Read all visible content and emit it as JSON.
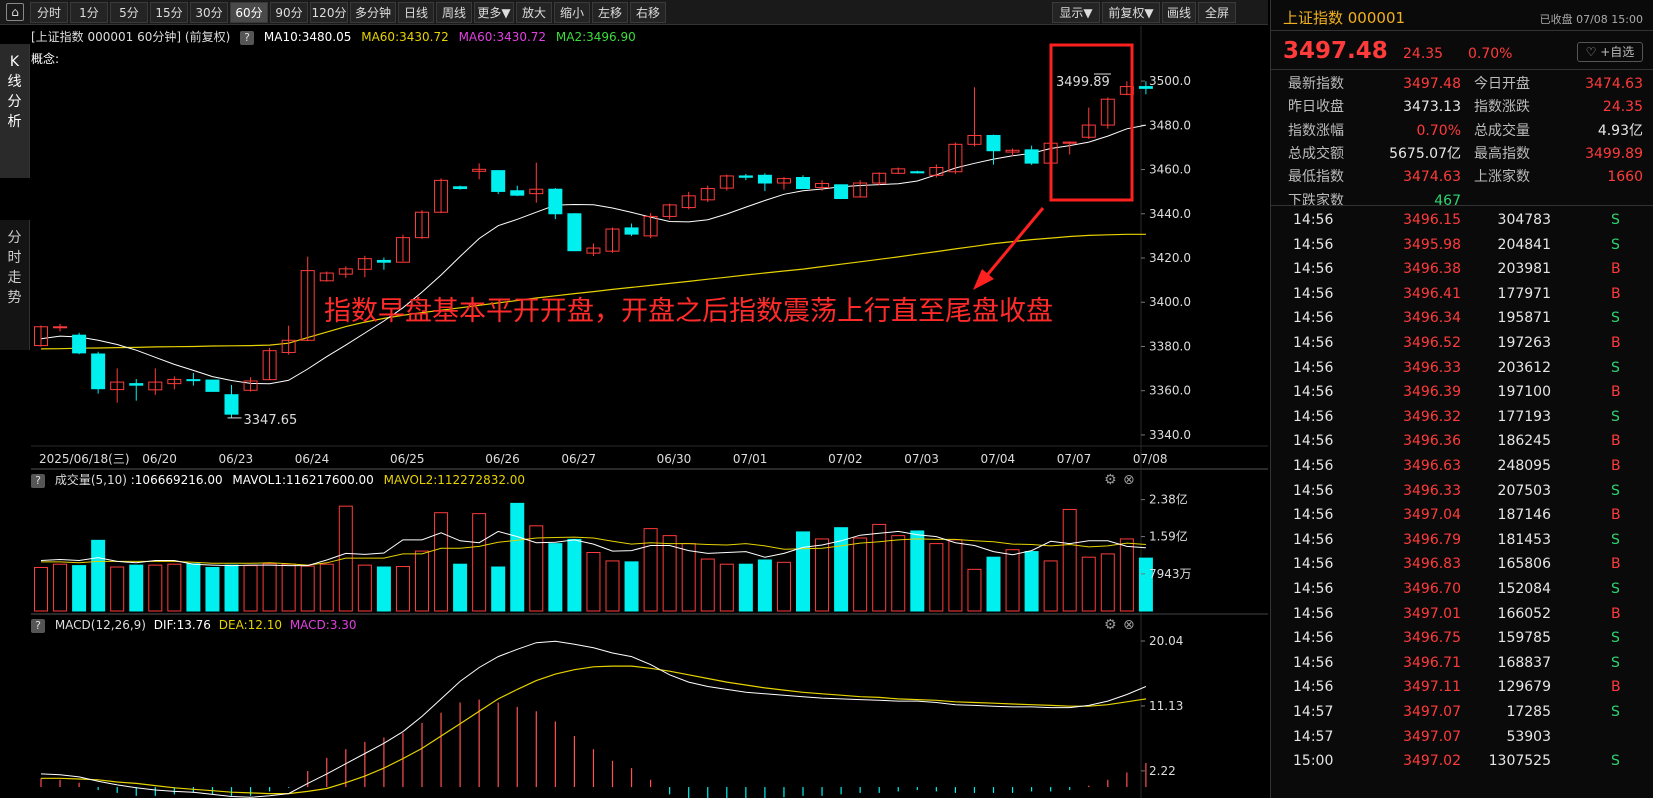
{
  "toolbar": {
    "home_icon": "home-icon",
    "periods": [
      "分时",
      "1分",
      "5分",
      "15分",
      "30分",
      "60分",
      "90分",
      "120分",
      "多分钟",
      "日线",
      "周线",
      "更多▼",
      "放大",
      "缩小",
      "左移",
      "右移"
    ],
    "active_period": "60分",
    "right": [
      "显示▼",
      "前复权▼",
      "画线",
      "全屏"
    ]
  },
  "side_tabs": [
    {
      "label": "K线分析",
      "active": true
    },
    {
      "label": "分时走势",
      "active": false
    }
  ],
  "kline_header": {
    "title": "[上证指数 000001 60分钟] (前复权)",
    "help": "?",
    "ma10": "MA10:3480.05",
    "ma60a": "MA60:3430.72",
    "ma60b": "MA60:3430.72",
    "ma2": "MA2:3496.90",
    "concept": "概念:"
  },
  "annotation": {
    "text": "指数早盘基本平开开盘，开盘之后指数震荡上行直至尾盘收盘",
    "high_label": "3499.89",
    "low_label": "3347.65"
  },
  "price_axis": [
    "3500.0",
    "3480.0",
    "3460.0",
    "3440.0",
    "3420.0",
    "3400.0",
    "3380.0",
    "3360.0",
    "3340.0"
  ],
  "date_axis": [
    "2025/06/18(三)",
    "06/20",
    "06/23",
    "06/24",
    "06/25",
    "06/26",
    "06/27",
    "06/30",
    "07/01",
    "07/02",
    "07/03",
    "07/04",
    "07/07",
    "07/08"
  ],
  "volume_header": {
    "help": "?",
    "vol": "成交量(5,10)",
    "vol_value": ":106669216.00",
    "mavol1": "MAVOL1:116217600.00",
    "mavol2": "MAVOL2:112272832.00",
    "gear_icon": "gear-icon",
    "close_icon": "close-icon"
  },
  "volume_axis": [
    "2.38亿",
    "1.59亿",
    "7943万"
  ],
  "macd_header": {
    "help": "?",
    "macd": "MACD(12,26,9)",
    "dif": "DIF:13.76",
    "dea": "DEA:12.10",
    "macd_val": "MACD:3.30"
  },
  "macd_axis": [
    "20.04",
    "11.13",
    "2.22"
  ],
  "colors": {
    "up": "#ff3b3b",
    "down": "#00f0f0",
    "ma10": "#ffffff",
    "ma60": "#e6d200",
    "macd_red": "#ff5050",
    "accent_box": "#ff2020"
  },
  "chart_data": [
    {
      "type": "candlestick",
      "title": "上证指数 000001 60分钟",
      "ylim": [
        3335,
        3505
      ],
      "candles": [
        [
          3380.4,
          3388.9,
          3380.0,
          3389.5
        ],
        [
          3388.9,
          3388.9,
          3386.8,
          3390.2
        ],
        [
          3385.1,
          3377.1,
          3376.5,
          3386.2
        ],
        [
          3376.6,
          3360.9,
          3358.7,
          3377.6
        ],
        [
          3360.5,
          3363.9,
          3354.6,
          3370.1
        ],
        [
          3363.2,
          3362.5,
          3355.5,
          3365.3
        ],
        [
          3360.4,
          3363.9,
          3358.1,
          3370.1
        ],
        [
          3363.2,
          3365.1,
          3360.6,
          3366.5
        ],
        [
          3365.0,
          3364.7,
          3362.3,
          3368.0
        ],
        [
          3364.8,
          3359.7,
          3359.7,
          3364.8
        ],
        [
          3358.2,
          3349.4,
          3347.7,
          3362.6
        ],
        [
          3360.2,
          3364.4,
          3359.6,
          3366.1
        ],
        [
          3365.0,
          3378.1,
          3364.8,
          3379.4
        ],
        [
          3377.3,
          3382.8,
          3376.3,
          3389.4
        ],
        [
          3382.8,
          3414.3,
          3382.4,
          3420.6
        ],
        [
          3409.7,
          3413.2,
          3409.3,
          3413.9
        ],
        [
          3412.7,
          3415.1,
          3411.0,
          3416.2
        ],
        [
          3414.9,
          3419.7,
          3411.3,
          3421.0
        ],
        [
          3418.9,
          3418.1,
          3414.7,
          3420.2
        ],
        [
          3418.1,
          3429.2,
          3418.5,
          3430.6
        ],
        [
          3429.2,
          3440.7,
          3428.7,
          3441.6
        ],
        [
          3440.7,
          3455.1,
          3440.3,
          3456.0
        ],
        [
          3452.2,
          3451.4,
          3450.9,
          3452.7
        ],
        [
          3459.2,
          3460.1,
          3455.6,
          3462.8
        ],
        [
          3459.5,
          3450.1,
          3448.9,
          3459.5
        ],
        [
          3450.4,
          3448.4,
          3448.0,
          3452.7
        ],
        [
          3449.1,
          3451.1,
          3445.0,
          3463.1
        ],
        [
          3451.1,
          3440.0,
          3437.6,
          3451.6
        ],
        [
          3440.0,
          3423.3,
          3423.1,
          3440.3
        ],
        [
          3422.2,
          3424.5,
          3420.9,
          3426.6
        ],
        [
          3423.1,
          3433.1,
          3422.3,
          3433.8
        ],
        [
          3433.6,
          3430.8,
          3429.9,
          3435.6
        ],
        [
          3430.0,
          3438.8,
          3429.0,
          3440.3
        ],
        [
          3438.8,
          3444.0,
          3437.4,
          3444.6
        ],
        [
          3442.8,
          3448.1,
          3442.0,
          3449.9
        ],
        [
          3446.3,
          3451.4,
          3445.3,
          3452.7
        ],
        [
          3451.6,
          3457.1,
          3450.5,
          3457.7
        ],
        [
          3457.1,
          3456.5,
          3455.2,
          3458.0
        ],
        [
          3457.4,
          3453.9,
          3450.3,
          3458.3
        ],
        [
          3453.9,
          3455.9,
          3450.9,
          3456.6
        ],
        [
          3456.4,
          3451.4,
          3451.3,
          3457.4
        ],
        [
          3451.9,
          3453.7,
          3450.4,
          3455.2
        ],
        [
          3453.1,
          3446.9,
          3446.9,
          3453.1
        ],
        [
          3447.6,
          3453.9,
          3447.4,
          3455.2
        ],
        [
          3453.9,
          3458.3,
          3452.9,
          3458.7
        ],
        [
          3458.3,
          3460.3,
          3458.0,
          3460.9
        ],
        [
          3459.0,
          3458.5,
          3458.2,
          3459.5
        ],
        [
          3457.4,
          3460.9,
          3456.4,
          3462.3
        ],
        [
          3459.0,
          3471.4,
          3458.0,
          3472.2
        ],
        [
          3471.4,
          3475.4,
          3470.5,
          3497.2
        ],
        [
          3475.4,
          3468.5,
          3462.2,
          3475.8
        ],
        [
          3467.9,
          3468.7,
          3466.0,
          3469.5
        ],
        [
          3468.9,
          3462.9,
          3462.1,
          3470.8
        ],
        [
          3462.9,
          3471.9,
          3461.8,
          3472.3
        ],
        [
          3471.9,
          3472.4,
          3466.8,
          3472.6
        ],
        [
          3474.6,
          3480.1,
          3473.8,
          3488.0
        ],
        [
          3480.1,
          3491.8,
          3478.5,
          3492.6
        ],
        [
          3494.0,
          3497.5,
          3493.6,
          3499.9
        ],
        [
          3497.5,
          3496.7,
          3494.0,
          3499.9
        ]
      ]
    },
    {
      "type": "bar",
      "title": "成交量(5,10)",
      "ylim": [
        0,
        2.5
      ],
      "unit": "亿",
      "values": [
        0.93,
        1.0,
        0.97,
        1.51,
        0.94,
        0.98,
        0.98,
        1.0,
        1.01,
        0.93,
        0.98,
        0.97,
        1.01,
        1.0,
        0.96,
        1.0,
        2.24,
        0.98,
        0.94,
        0.95,
        1.28,
        2.1,
        1.0,
        2.08,
        0.94,
        2.3,
        1.82,
        1.44,
        1.53,
        1.25,
        1.07,
        1.05,
        1.76,
        1.61,
        1.44,
        1.11,
        1.0,
        1.0,
        1.09,
        1.04,
        1.69,
        1.54,
        1.78,
        1.56,
        1.85,
        1.61,
        1.71,
        1.44,
        1.52,
        0.89,
        1.15,
        1.31,
        1.27,
        1.07,
        2.17,
        1.15,
        1.22,
        1.54,
        1.13
      ],
      "mavol1": [
        1.08,
        1.1,
        1.08,
        1.14,
        1.06,
        1.03,
        1.08,
        1.08,
        1.0,
        0.98,
        0.97,
        0.98,
        0.98,
        0.97,
        0.97,
        1.09,
        1.23,
        1.21,
        1.24,
        1.52,
        1.52,
        1.67,
        1.5,
        1.46,
        1.7,
        1.59,
        1.46,
        1.47,
        1.52,
        1.43,
        1.28,
        1.29,
        1.4,
        1.4,
        1.29,
        1.23,
        1.25,
        1.27,
        1.15,
        1.23,
        1.36,
        1.41,
        1.5,
        1.62,
        1.66,
        1.7,
        1.63,
        1.59,
        1.46,
        1.4,
        1.27,
        1.2,
        1.29,
        1.49,
        1.44,
        1.5,
        1.5,
        1.38,
        1.35
      ],
      "mavol2": [
        1.05,
        1.05,
        1.03,
        1.06,
        1.06,
        1.06,
        1.06,
        1.06,
        1.04,
        1.02,
        1.02,
        1.02,
        1.03,
        1.01,
        0.98,
        1.03,
        1.13,
        1.13,
        1.13,
        1.22,
        1.22,
        1.34,
        1.34,
        1.38,
        1.47,
        1.51,
        1.56,
        1.57,
        1.58,
        1.56,
        1.49,
        1.43,
        1.46,
        1.44,
        1.44,
        1.42,
        1.41,
        1.44,
        1.39,
        1.32,
        1.33,
        1.34,
        1.39,
        1.45,
        1.48,
        1.52,
        1.54,
        1.53,
        1.53,
        1.5,
        1.48,
        1.43,
        1.42,
        1.39,
        1.42,
        1.37,
        1.39,
        1.45,
        1.42
      ]
    },
    {
      "type": "line",
      "title": "MACD(12,26,9)",
      "ylim": [
        -1.5,
        21
      ],
      "dif": [
        1.8,
        1.7,
        1.4,
        0.8,
        0.3,
        -0.1,
        -0.4,
        -0.6,
        -0.7,
        -1.0,
        -1.3,
        -1.4,
        -1.2,
        -0.9,
        0.5,
        1.8,
        3.2,
        4.6,
        6.0,
        7.6,
        9.7,
        12.1,
        14.5,
        16.4,
        17.9,
        18.9,
        19.8,
        20.0,
        19.6,
        19.1,
        18.4,
        17.9,
        16.8,
        15.4,
        14.4,
        13.8,
        13.4,
        13.0,
        12.8,
        12.6,
        12.4,
        12.2,
        12.1,
        12.0,
        11.9,
        11.8,
        11.8,
        11.6,
        11.3,
        11.2,
        11.1,
        11.0,
        11.0,
        10.9,
        10.9,
        11.2,
        11.8,
        12.7,
        13.8
      ],
      "dea": [
        1.2,
        1.2,
        1.1,
        1.0,
        0.7,
        0.5,
        0.2,
        -0.1,
        -0.3,
        -0.5,
        -0.7,
        -0.8,
        -0.9,
        -0.9,
        -0.6,
        -0.2,
        0.6,
        1.5,
        2.6,
        3.9,
        5.3,
        7.0,
        8.7,
        10.4,
        12.1,
        13.4,
        14.6,
        15.5,
        16.1,
        16.5,
        16.6,
        16.6,
        16.3,
        15.9,
        15.4,
        14.9,
        14.4,
        14.0,
        13.6,
        13.3,
        13.0,
        12.8,
        12.6,
        12.4,
        12.3,
        12.1,
        12.0,
        11.9,
        11.7,
        11.6,
        11.5,
        11.4,
        11.3,
        11.2,
        11.1,
        11.1,
        11.3,
        11.7,
        12.1
      ],
      "macd": [
        1.2,
        1.0,
        0.6,
        -0.4,
        -0.8,
        -1.2,
        -1.2,
        -1.0,
        -0.8,
        -1.0,
        -1.2,
        -1.2,
        -0.6,
        -0.1,
        2.2,
        4.0,
        5.2,
        6.2,
        6.8,
        7.4,
        8.8,
        10.2,
        11.6,
        12.0,
        11.6,
        11.0,
        10.4,
        9.0,
        7.0,
        5.2,
        3.6,
        2.6,
        1.0,
        -1.0,
        -2.0,
        -2.2,
        -2.0,
        -2.0,
        -1.6,
        -1.4,
        -1.2,
        -1.2,
        -1.0,
        -0.8,
        -0.8,
        -0.6,
        -0.4,
        -0.6,
        -0.8,
        -0.8,
        -0.8,
        -0.8,
        -0.6,
        -0.6,
        -0.4,
        0.2,
        1.0,
        2.0,
        3.3
      ]
    }
  ],
  "ma10": [
    3383.5,
    3384.7,
    3384.3,
    3382.8,
    3380.9,
    3378.3,
    3375.1,
    3371.9,
    3369.2,
    3366.4,
    3364.6,
    3363.3,
    3363.1,
    3364.7,
    3369.8,
    3375.4,
    3380.6,
    3386.1,
    3391.5,
    3397.5,
    3404.6,
    3412.3,
    3420.7,
    3428.8,
    3434.6,
    3437.5,
    3440.7,
    3443.9,
    3444.2,
    3444.1,
    3442.6,
    3440.6,
    3438.5,
    3436.5,
    3436.3,
    3437.3,
    3439.9,
    3443.0,
    3446.0,
    3448.8,
    3450.4,
    3451.2,
    3452.2,
    3452.8,
    3453.2,
    3453.6,
    3454.8,
    3457.6,
    3460.7,
    3462.8,
    3464.7,
    3466.2,
    3467.4,
    3469.5,
    3470.8,
    3472.4,
    3475.1,
    3478.4,
    3480.1
  ],
  "ma60": [
    3378.9,
    3379.0,
    3379.2,
    3379.3,
    3379.5,
    3379.6,
    3379.8,
    3379.9,
    3380.0,
    3380.2,
    3380.3,
    3380.4,
    3380.6,
    3381.5,
    3384.0,
    3386.5,
    3389.0,
    3391.0,
    3392.7,
    3394.1,
    3395.3,
    3396.4,
    3397.5,
    3398.6,
    3399.7,
    3400.8,
    3401.9,
    3402.9,
    3403.9,
    3404.8,
    3405.8,
    3406.7,
    3407.6,
    3408.5,
    3409.4,
    3410.4,
    3411.3,
    3412.3,
    3413.2,
    3414.1,
    3415.0,
    3416.1,
    3417.2,
    3418.3,
    3419.4,
    3420.5,
    3421.7,
    3422.9,
    3424.1,
    3425.3,
    3426.5,
    3427.4,
    3428.3,
    3429.0,
    3429.7,
    3430.2,
    3430.5,
    3430.7,
    3430.7
  ],
  "quote": {
    "name": "上证指数 000001",
    "status": "已收盘 07/08 15:00",
    "price": "3497.48",
    "change": "24.35",
    "pct": "0.70%",
    "fav_label": "♡ +自选",
    "stats": [
      {
        "label": "最新指数",
        "value": "3497.48",
        "color": "red"
      },
      {
        "label": "今日开盘",
        "value": "3474.63",
        "color": "red"
      },
      {
        "label": "昨日收盘",
        "value": "3473.13",
        "color": "white"
      },
      {
        "label": "指数涨跌",
        "value": "24.35",
        "color": "red"
      },
      {
        "label": "指数涨幅",
        "value": "0.70%",
        "color": "red"
      },
      {
        "label": "总成交量",
        "value": "4.93亿",
        "color": "white"
      },
      {
        "label": "总成交额",
        "value": "5675.07亿",
        "color": "white"
      },
      {
        "label": "最高指数",
        "value": "3499.89",
        "color": "red"
      },
      {
        "label": "最低指数",
        "value": "3474.63",
        "color": "red"
      },
      {
        "label": "上涨家数",
        "value": "1660",
        "color": "red"
      },
      {
        "label": "下跌家数",
        "value": "467",
        "color": "green"
      }
    ],
    "ticks": [
      {
        "t": "14:56",
        "p": "3496.15",
        "v": "304783",
        "s": "S"
      },
      {
        "t": "14:56",
        "p": "3495.98",
        "v": "204841",
        "s": "S"
      },
      {
        "t": "14:56",
        "p": "3496.38",
        "v": "203981",
        "s": "B"
      },
      {
        "t": "14:56",
        "p": "3496.41",
        "v": "177971",
        "s": "B"
      },
      {
        "t": "14:56",
        "p": "3496.34",
        "v": "195871",
        "s": "S"
      },
      {
        "t": "14:56",
        "p": "3496.52",
        "v": "197263",
        "s": "B"
      },
      {
        "t": "14:56",
        "p": "3496.33",
        "v": "203612",
        "s": "S"
      },
      {
        "t": "14:56",
        "p": "3496.39",
        "v": "197100",
        "s": "B"
      },
      {
        "t": "14:56",
        "p": "3496.32",
        "v": "177193",
        "s": "S"
      },
      {
        "t": "14:56",
        "p": "3496.36",
        "v": "186245",
        "s": "B"
      },
      {
        "t": "14:56",
        "p": "3496.63",
        "v": "248095",
        "s": "B"
      },
      {
        "t": "14:56",
        "p": "3496.33",
        "v": "207503",
        "s": "S"
      },
      {
        "t": "14:56",
        "p": "3497.04",
        "v": "187146",
        "s": "B"
      },
      {
        "t": "14:56",
        "p": "3496.79",
        "v": "181453",
        "s": "S"
      },
      {
        "t": "14:56",
        "p": "3496.83",
        "v": "165806",
        "s": "B"
      },
      {
        "t": "14:56",
        "p": "3496.70",
        "v": "152084",
        "s": "S"
      },
      {
        "t": "14:56",
        "p": "3497.01",
        "v": "166052",
        "s": "B"
      },
      {
        "t": "14:56",
        "p": "3496.75",
        "v": "159785",
        "s": "S"
      },
      {
        "t": "14:56",
        "p": "3496.71",
        "v": "168837",
        "s": "S"
      },
      {
        "t": "14:56",
        "p": "3497.11",
        "v": "129679",
        "s": "B"
      },
      {
        "t": "14:57",
        "p": "3497.07",
        "v": "17285",
        "s": "S"
      },
      {
        "t": "14:57",
        "p": "3497.07",
        "v": "53903",
        "s": ""
      },
      {
        "t": "15:00",
        "p": "3497.02",
        "v": "1307525",
        "s": "S"
      }
    ]
  }
}
